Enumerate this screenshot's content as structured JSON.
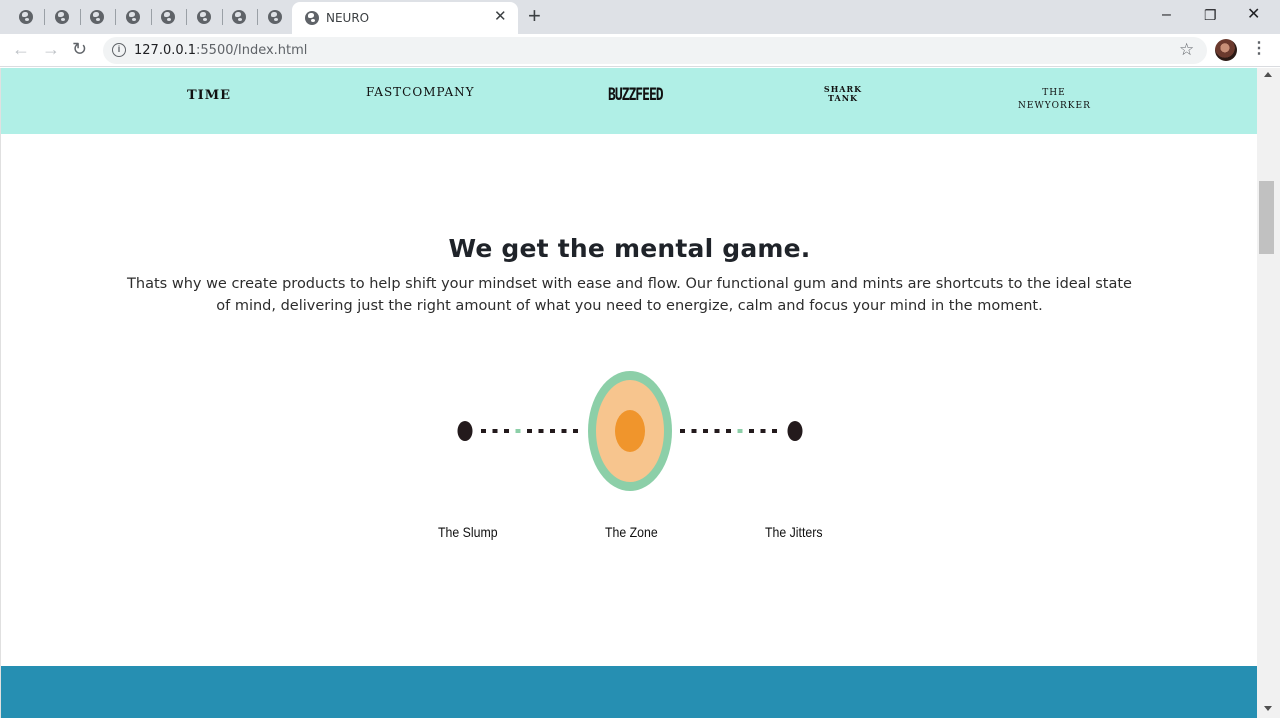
{
  "browser": {
    "tab": {
      "title": "NEURO",
      "close": "✕"
    },
    "new_tab": "+",
    "window": {
      "minimize": "–",
      "restore": "❐",
      "close": "✕"
    },
    "nav": {
      "back": "←",
      "forward": "→",
      "reload": "↻"
    },
    "address": {
      "host": "127.0.0.1",
      "rest": ":5500/Index.html"
    },
    "bookmark_icon": "star-icon",
    "menu": "⋮"
  },
  "press": {
    "logos": [
      "TIME",
      "FASTCOMPANY",
      "BUZZFEED",
      "SHARK TANK",
      "THE NEWYORKER"
    ],
    "background": "#b0efe6"
  },
  "section": {
    "heading": "We get the mental game.",
    "description": "Thats why we create products to help shift your mindset with ease and flow. Our functional gum and mints are shortcuts to the ideal state of mind, delivering just the right amount of what you need to energize, calm and focus your mind in the moment."
  },
  "scale": {
    "stages": [
      "The Slump",
      "The Zone",
      "The Jitters"
    ],
    "colors": {
      "dot": "#231a1c",
      "dash": "#231a1c",
      "dash_accent": "#8ccfa8",
      "outer_ring": "#8ccfa8",
      "inner_fill": "#f7c58e",
      "core": "#f0952c"
    }
  },
  "footer": {
    "background": "#268fb2"
  }
}
